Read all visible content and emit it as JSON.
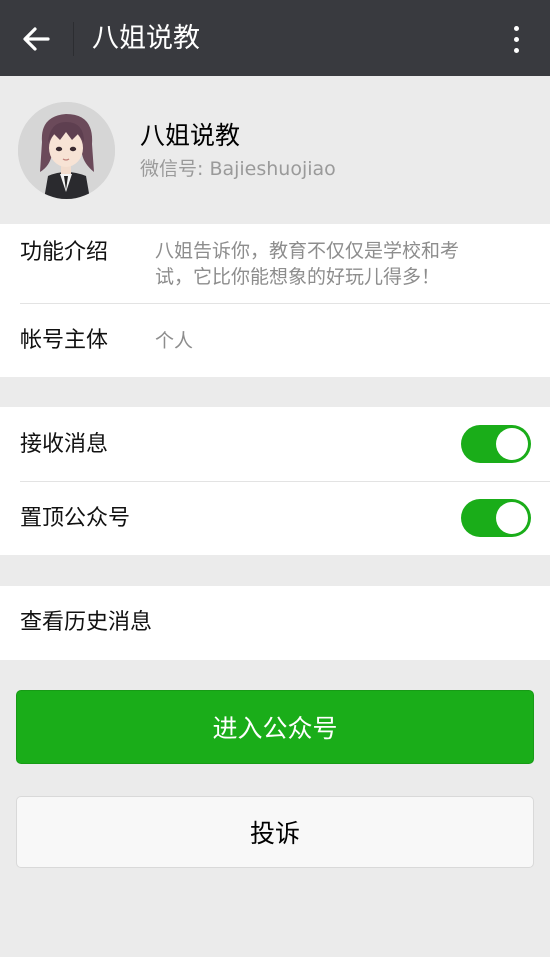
{
  "topbar": {
    "title": "八姐说教",
    "back_icon": "arrow-left-icon",
    "more_icon": "more-vertical-icon"
  },
  "profile": {
    "name": "八姐说教",
    "wechat_id": "微信号: Bajieshuojiao"
  },
  "info": {
    "function_label": "功能介绍",
    "function_line1": "八姐告诉你，教育不仅仅是学校和考",
    "function_line2": "试，它比你能想象的好玩儿得多！",
    "owner_label": "帐号主体",
    "owner_value": "个人"
  },
  "settings": {
    "receive_label": "接收消息",
    "receive_on": true,
    "pin_label": "置顶公众号",
    "pin_on": true
  },
  "history": {
    "label": "查看历史消息"
  },
  "actions": {
    "enter_label": "进入公众号",
    "report_label": "投诉"
  },
  "colors": {
    "topbar": "#393a3f",
    "accent_green": "#1aad19",
    "background": "#ebebeb"
  }
}
